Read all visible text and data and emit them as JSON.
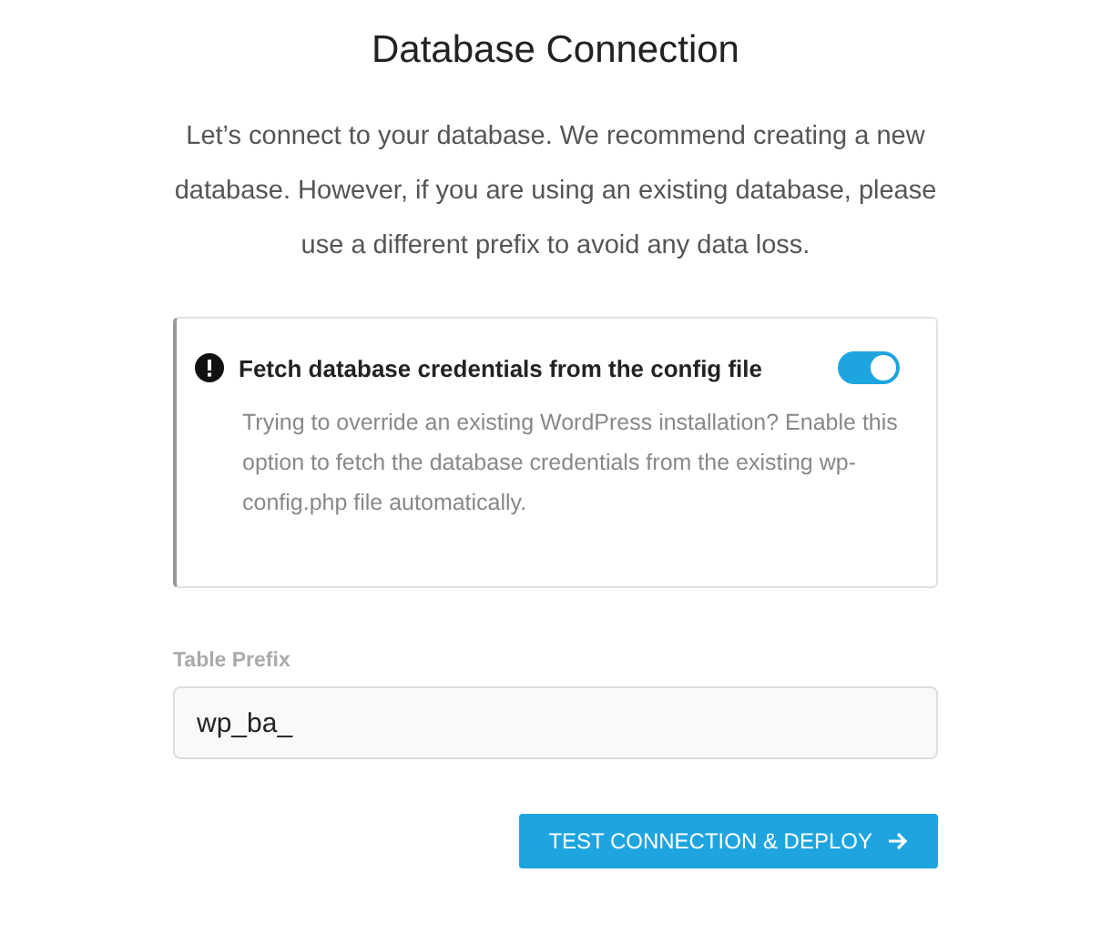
{
  "title": "Database Connection",
  "intro": "Let’s connect to your database. We recommend creating a new database. However, if you are using an existing database, please use a different prefix to avoid any data loss.",
  "notice": {
    "title": "Fetch database credentials from the config file",
    "on": true,
    "description": "Trying to override an existing WordPress installation? Enable this option to fetch the database credentials from the existing wp-config.php file automatically."
  },
  "field": {
    "label": "Table Prefix",
    "value": "wp_ba_"
  },
  "button": {
    "label": "TEST CONNECTION & DEPLOY"
  }
}
